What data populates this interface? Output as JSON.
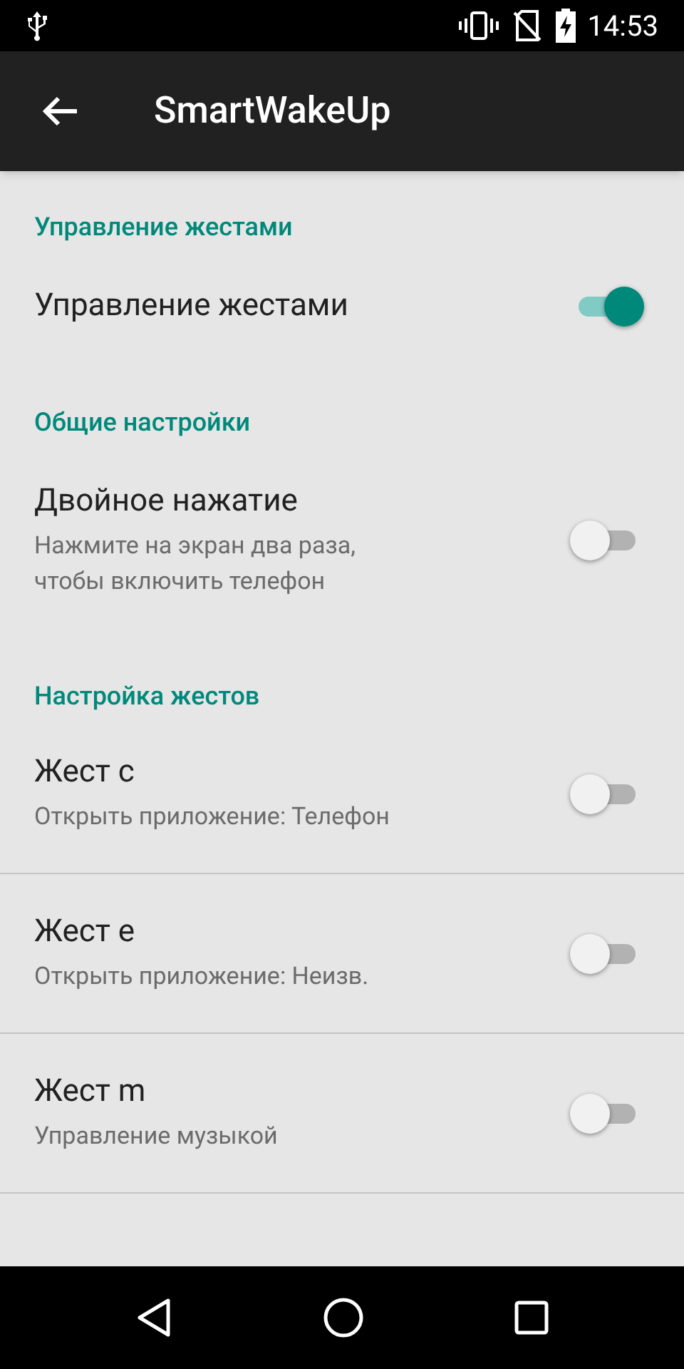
{
  "status_bar": {
    "time": "14:53"
  },
  "app_bar": {
    "title": "SmartWakeUp"
  },
  "sections": [
    {
      "header": "Управление жестами",
      "items": [
        {
          "title": "Управление жестами",
          "on": true
        }
      ]
    },
    {
      "header": "Общие настройки",
      "items": [
        {
          "title": "Двойное нажатие",
          "summary": "Нажмите на экран два раза, чтобы включить телефон",
          "on": false
        }
      ]
    },
    {
      "header": "Настройка жестов",
      "items": [
        {
          "title": "Жест c",
          "summary": "Открыть приложение: Телефон",
          "on": false
        },
        {
          "title": "Жест e",
          "summary": "Открыть приложение: Неизв.",
          "on": false
        },
        {
          "title": "Жест m",
          "summary": "Управление музыкой",
          "on": false
        }
      ]
    }
  ]
}
